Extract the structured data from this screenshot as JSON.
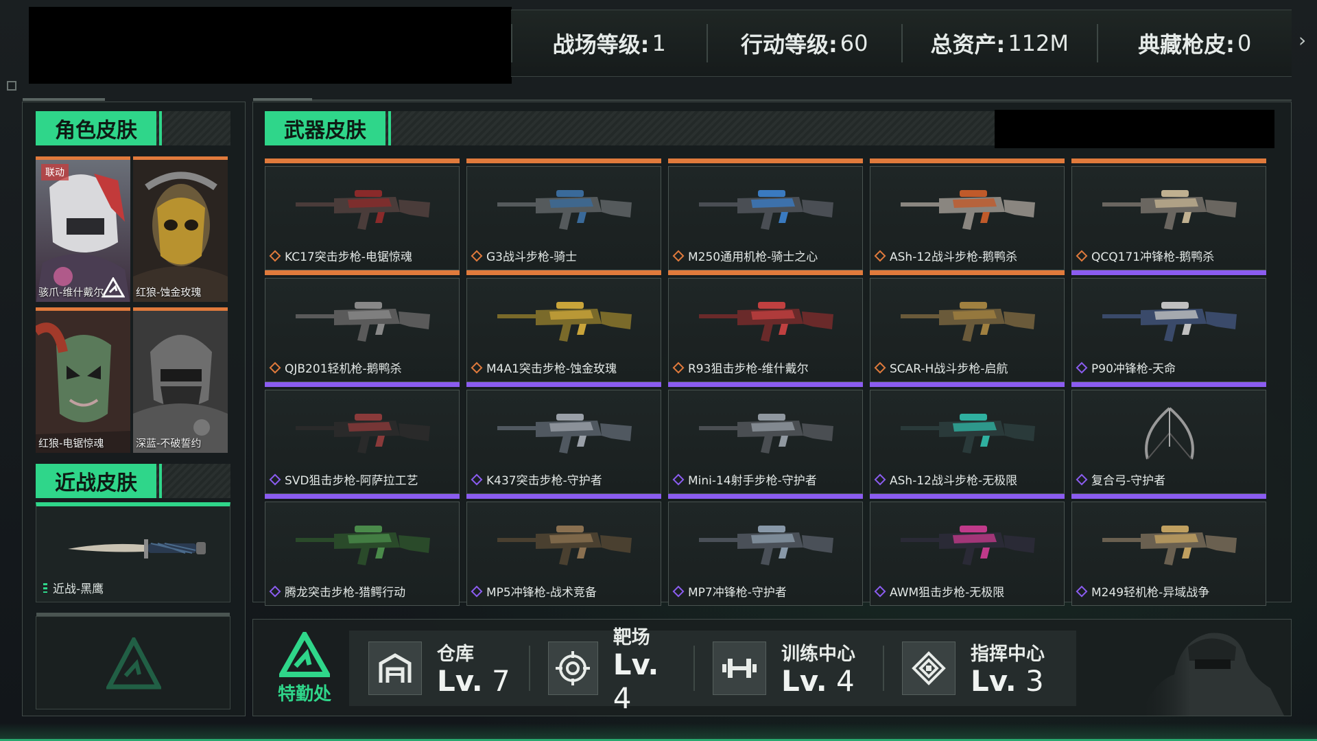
{
  "header": {
    "stats": [
      {
        "label": "战场等级:",
        "value": "1"
      },
      {
        "label": "行动等级:",
        "value": "60"
      },
      {
        "label": "总资产:",
        "value": "112M"
      },
      {
        "label": "典藏枪皮:",
        "value": "0"
      }
    ]
  },
  "character_section": {
    "title": "角色皮肤",
    "cards": [
      {
        "label": "骇爪-维什戴尔",
        "badge": "联动",
        "rarity_color": "#e07a3c"
      },
      {
        "label": "红狼-蚀金玫瑰",
        "rarity_color": "#e07a3c"
      },
      {
        "label": "红狼-电锯惊魂",
        "rarity_color": "#e07a3c"
      },
      {
        "label": "深蓝-不破誓约",
        "rarity_color": "#e07a3c"
      }
    ]
  },
  "melee_section": {
    "title": "近战皮肤",
    "item": {
      "label": "近战-黑鹰",
      "rarity_color": "#2fd68a"
    }
  },
  "weapon_section": {
    "title": "武器皮肤",
    "items": [
      {
        "label": "KC17突击步枪-电锯惊魂",
        "rarity": "orange"
      },
      {
        "label": "G3战斗步枪-骑士",
        "rarity": "orange"
      },
      {
        "label": "M250通用机枪-骑士之心",
        "rarity": "orange"
      },
      {
        "label": "ASh-12战斗步枪-鹅鸭杀",
        "rarity": "orange"
      },
      {
        "label": "QCQ171冲锋枪-鹅鸭杀",
        "rarity": "orange"
      },
      {
        "label": "QJB201轻机枪-鹅鸭杀",
        "rarity": "orange"
      },
      {
        "label": "M4A1突击步枪-蚀金玫瑰",
        "rarity": "orange"
      },
      {
        "label": "R93狙击步枪-维什戴尔",
        "rarity": "orange"
      },
      {
        "label": "SCAR-H战斗步枪-启航",
        "rarity": "orange"
      },
      {
        "label": "P90冲锋枪-天命",
        "rarity": "purple"
      },
      {
        "label": "SVD狙击步枪-阿萨拉工艺",
        "rarity": "purple"
      },
      {
        "label": "K437突击步枪-守护者",
        "rarity": "purple"
      },
      {
        "label": "Mini-14射手步枪-守护者",
        "rarity": "purple"
      },
      {
        "label": "ASh-12战斗步枪-无极限",
        "rarity": "purple"
      },
      {
        "label": "复合弓-守护者",
        "rarity": "purple"
      },
      {
        "label": "腾龙突击步枪-猎鳄行动",
        "rarity": "purple"
      },
      {
        "label": "MP5冲锋枪-战术竞备",
        "rarity": "purple"
      },
      {
        "label": "MP7冲锋枪-守护者",
        "rarity": "purple"
      },
      {
        "label": "AWM狙击步枪-无极限",
        "rarity": "purple"
      },
      {
        "label": "M249轻机枪-异域战争",
        "rarity": "purple"
      }
    ],
    "rarity_colors": {
      "orange": "#e07a3c",
      "purple": "#8b5cf0"
    }
  },
  "facilities": {
    "agency_label": "特勤处",
    "items": [
      {
        "name": "仓库",
        "lv_prefix": "Lv.",
        "level": "7",
        "icon": "warehouse-icon"
      },
      {
        "name": "靶场",
        "lv_prefix": "Lv.",
        "level": "4",
        "icon": "target-icon"
      },
      {
        "name": "训练中心",
        "lv_prefix": "Lv.",
        "level": "4",
        "icon": "dumbbell-icon"
      },
      {
        "name": "指挥中心",
        "lv_prefix": "Lv.",
        "level": "3",
        "icon": "command-icon"
      }
    ]
  },
  "colors": {
    "accent": "#2fd68a",
    "orange": "#e07a3c",
    "purple": "#8b5cf0"
  }
}
